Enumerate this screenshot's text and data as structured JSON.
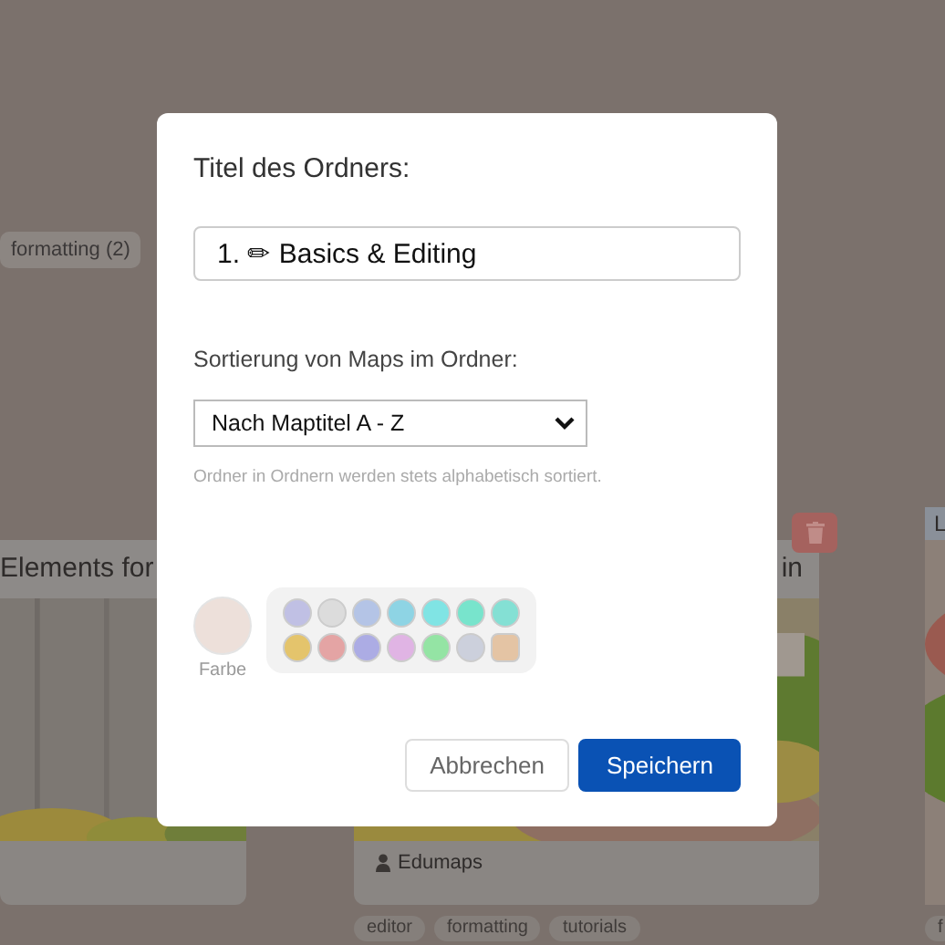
{
  "backdrop": {
    "filter_chips": [
      {
        "label": "formatting (2)"
      }
    ],
    "cards": [
      {
        "title": "Elements for",
        "deletable": false
      },
      {
        "title": "in",
        "author": "Edumaps",
        "tags": [
          "editor",
          "formatting",
          "tutorials"
        ],
        "deletable": true
      },
      {
        "title": "L",
        "tags": [
          "f"
        ],
        "deletable": false
      }
    ]
  },
  "dialog": {
    "title_label": "Titel des Ordners:",
    "title_field": {
      "value": "1. ✏ Basics & Editing"
    },
    "sort_label": "Sortierung von Maps im Ordner:",
    "sort_select": {
      "value": "Nach Maptitel A - Z"
    },
    "sort_hint": "Ordner in Ordnern werden stets alphabetisch sortiert.",
    "color_preview": {
      "color": "#ede0da",
      "label": "Farbe"
    },
    "swatches": [
      {
        "color": "#c0c0e4",
        "selected": false
      },
      {
        "color": "#dcdcdc",
        "selected": false
      },
      {
        "color": "#b4c4e6",
        "selected": false
      },
      {
        "color": "#8ed4e4",
        "selected": false
      },
      {
        "color": "#80e4e4",
        "selected": false
      },
      {
        "color": "#78e4cc",
        "selected": false
      },
      {
        "color": "#84e0d4",
        "selected": false
      },
      {
        "color": "#e4c46c",
        "selected": false
      },
      {
        "color": "#e4a4a4",
        "selected": false
      },
      {
        "color": "#acace4",
        "selected": false
      },
      {
        "color": "#e0b4e4",
        "selected": false
      },
      {
        "color": "#94e4a4",
        "selected": false
      },
      {
        "color": "#ccd0dc",
        "selected": false
      },
      {
        "color": "#e4c4a4",
        "selected": true
      }
    ],
    "buttons": [
      {
        "label": "Abbrechen",
        "kind": "secondary"
      },
      {
        "label": "Speichern",
        "kind": "primary"
      }
    ]
  }
}
